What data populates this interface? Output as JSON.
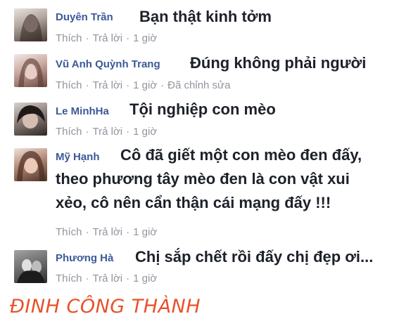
{
  "comments": [
    {
      "author": "Duyên Trần",
      "text": "Bạn thật kinh tởm",
      "like": "Thích",
      "reply": "Trả lời",
      "time": "1 giờ"
    },
    {
      "author": "Vũ Anh Quỳnh Trang",
      "text": "Đúng không phải người",
      "like": "Thích",
      "reply": "Trả lời",
      "time": "1 giờ",
      "edited": "Đã chỉnh sửa"
    },
    {
      "author": "Le MinhHa",
      "text": "Tội nghiệp con mèo",
      "like": "Thích",
      "reply": "Trả lời",
      "time": "1 giờ"
    },
    {
      "author": "Mỹ Hạnh",
      "text_lines": [
        "Cô đã giết một con mèo đen đấy,",
        "theo phương tây mèo đen là con vật xui",
        "xẻo, cô nên cẩn thận cái mạng đấy !!!"
      ],
      "like": "Thích",
      "reply": "Trả lời",
      "time": "1 giờ"
    },
    {
      "author": "Phương Hà",
      "text": "Chị sắp chết rồi đấy chị đẹp ơi...",
      "like": "Thích",
      "reply": "Trả lời",
      "time": "1 giờ"
    }
  ],
  "separator": "·",
  "watermark": "ĐINH CÔNG THÀNH"
}
